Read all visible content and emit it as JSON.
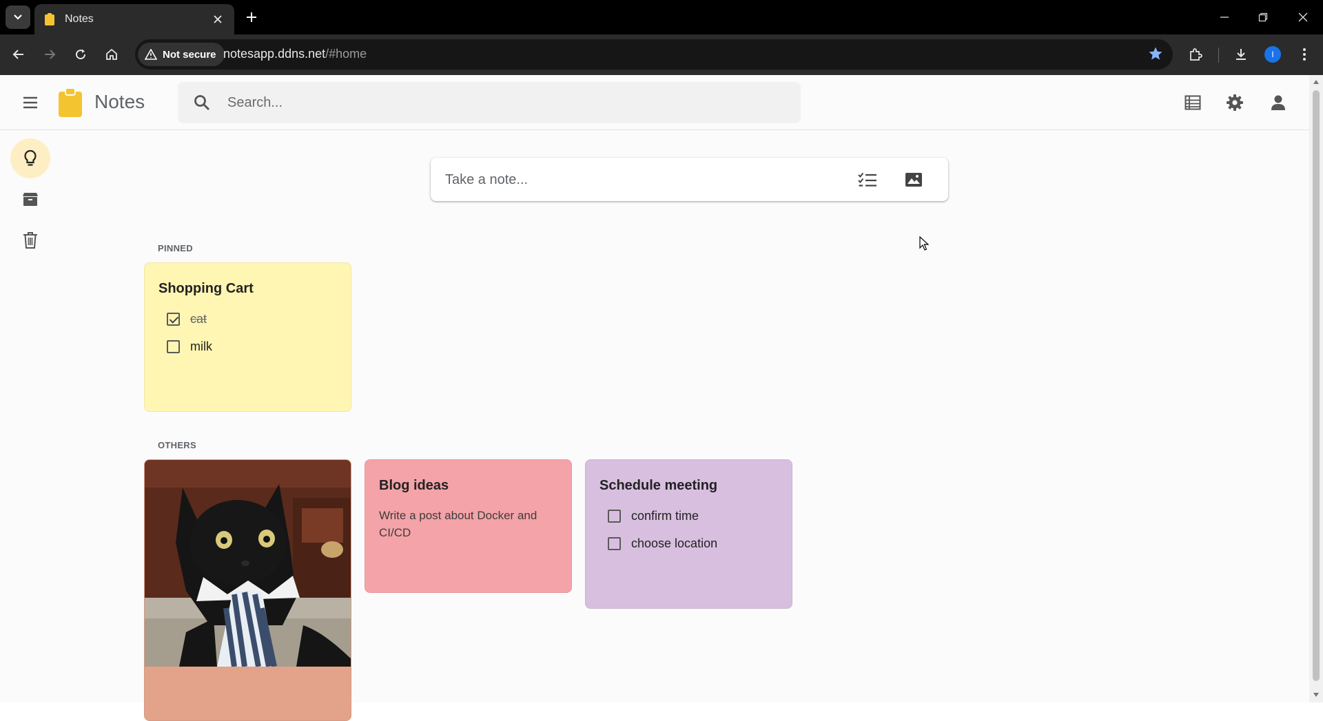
{
  "browser": {
    "tab_title": "Notes",
    "security_label": "Not secure",
    "url_host": "notesapp.ddns.net",
    "url_path": "/#home",
    "profile_initial": "I"
  },
  "app": {
    "title": "Notes",
    "search_placeholder": "Search...",
    "composer_placeholder": "Take a note...",
    "accent_color": "#f4c430"
  },
  "sidebar": {
    "items": [
      {
        "name": "notes",
        "icon": "lightbulb-icon",
        "active": true
      },
      {
        "name": "archive",
        "icon": "archive-icon",
        "active": false
      },
      {
        "name": "trash",
        "icon": "trash-icon",
        "active": false
      }
    ]
  },
  "sections": {
    "pinned_label": "PINNED",
    "others_label": "OTHERS"
  },
  "notes": {
    "shopping": {
      "title": "Shopping Cart",
      "color": "#fff6b3",
      "items": [
        {
          "text": "cat",
          "checked": true
        },
        {
          "text": "milk",
          "checked": false
        }
      ]
    },
    "image_note": {
      "color": "#e3a38a",
      "image_desc": "black cat wearing a striped tie"
    },
    "blog": {
      "title": "Blog ideas",
      "body": "Write a post about Docker and CI/CD",
      "color": "#f4a3a8"
    },
    "meeting": {
      "title": "Schedule meeting",
      "color": "#d8bfe0",
      "items": [
        {
          "text": "confirm time",
          "checked": false
        },
        {
          "text": "choose location",
          "checked": false
        }
      ]
    }
  }
}
